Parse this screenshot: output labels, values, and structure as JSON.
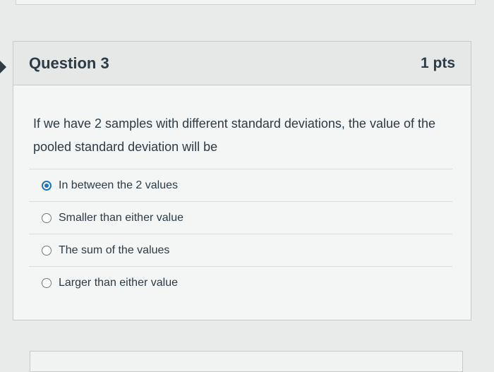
{
  "question": {
    "title": "Question 3",
    "points": "1 pts",
    "text": "If we have 2 samples with different standard deviations, the value of the pooled standard deviation will be",
    "answers": [
      {
        "label": "In between the 2 values",
        "selected": true
      },
      {
        "label": "Smaller than either value",
        "selected": false
      },
      {
        "label": "The sum of the values",
        "selected": false
      },
      {
        "label": "Larger than either value",
        "selected": false
      }
    ]
  },
  "colors": {
    "accent": "#1d73c9",
    "text": "#2d3b45",
    "border": "#c7cacc",
    "header_bg": "#e6e8e8"
  }
}
